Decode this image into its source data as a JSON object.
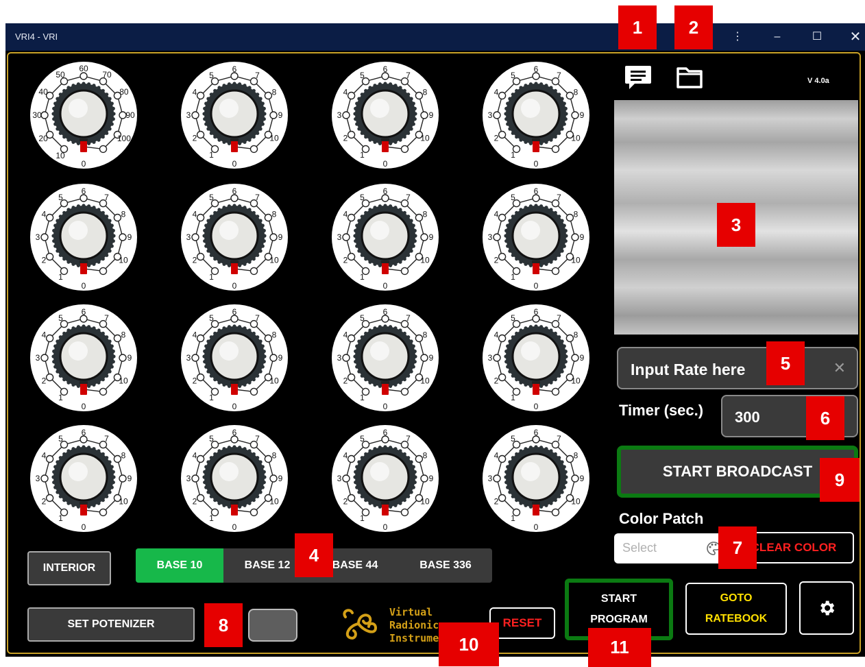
{
  "window": {
    "title": "VRI4 - VRI"
  },
  "header": {
    "version": "V 4.0a"
  },
  "dial_labels": {
    "base100": [
      "0",
      "10",
      "20",
      "30",
      "40",
      "50",
      "60",
      "70",
      "80",
      "90",
      "100"
    ],
    "base10": [
      "0",
      "1",
      "2",
      "3",
      "4",
      "5",
      "6",
      "7",
      "8",
      "9",
      "10"
    ]
  },
  "rate_input": {
    "placeholder": "Input Rate here"
  },
  "timer": {
    "label": "Timer (sec.)",
    "value": "300"
  },
  "broadcast": {
    "label": "START BROADCAST"
  },
  "color_patch": {
    "label": "Color Patch",
    "select_placeholder": "Select",
    "clear_label": "CLEAR COLOR"
  },
  "interior": {
    "label": "INTERIOR"
  },
  "base_selector": {
    "options": [
      "BASE 10",
      "BASE 12",
      "BASE 44",
      "BASE 336"
    ],
    "selected": "BASE 10"
  },
  "potenizer": {
    "label": "SET POTENIZER"
  },
  "logo": {
    "lines": [
      "Virtual",
      "Radionic",
      "Instrume"
    ]
  },
  "reset": {
    "label": "RESET"
  },
  "start_program": {
    "line1": "START",
    "line2": "PROGRAM"
  },
  "goto_ratebook": {
    "line1": "GOTO",
    "line2": "RATEBOOK"
  },
  "annotations": [
    "1",
    "2",
    "3",
    "4",
    "5",
    "6",
    "7",
    "8",
    "9",
    "10",
    "11"
  ],
  "colors": {
    "accent_green": "#17b84a",
    "frame_gold": "#c9a227",
    "badge_red": "#e60000",
    "reset_red": "#ff2020",
    "ratebook_yellow": "#ffe000"
  }
}
